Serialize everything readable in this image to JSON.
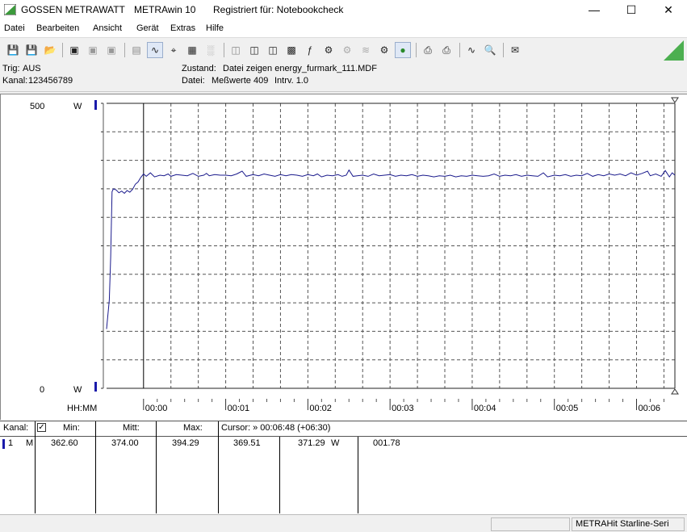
{
  "window": {
    "app_brand": "GOSSEN METRAWATT",
    "app_name": "METRAwin 10",
    "registration": "Registriert für: Notebookcheck"
  },
  "menu": [
    "Datei",
    "Bearbeiten",
    "Ansicht",
    "Gerät",
    "Extras",
    "Hilfe"
  ],
  "toolbar": {
    "icons": [
      "save-icon",
      "save-as-icon",
      "open-icon",
      "record-icon",
      "record-2-icon",
      "record-3-icon",
      "chart-view-icon",
      "zoom-chart-icon",
      "crosshair-icon",
      "table-view-icon",
      "histogram-icon",
      "device-icon",
      "device-2-icon",
      "device-3-icon",
      "computer-icon",
      "function-icon",
      "settings-icon",
      "settings-2-icon",
      "wave-icon",
      "trigger-icon",
      "start-icon",
      "print-icon",
      "print-preview-icon",
      "auto-scale-icon",
      "zoom-icon",
      "comment-icon"
    ],
    "accent": "#4caf50"
  },
  "info": {
    "trig_label": "Trig:",
    "trig_value": "AUS",
    "kanal_label": "Kanal:",
    "kanal_value": "123456789",
    "zustand_label": "Zustand:",
    "zustand_value": "Datei zeigen energy_furmark_111.MDF",
    "datei_label": "Datei:",
    "datei_value": "Meßwerte 409",
    "intrv_value": "Intrv. 1.0"
  },
  "chart_data": {
    "type": "line",
    "ymax_label": "500",
    "ymin_label": "0",
    "y_unit": "W",
    "ylim": [
      0,
      500
    ],
    "xlabel": "HH:MM",
    "x_ticks": [
      "00:00",
      "00:01",
      "00:02",
      "00:03",
      "00:04",
      "00:05",
      "00:06"
    ],
    "xlim_seconds": [
      -27,
      388
    ],
    "line_color": "#1a1a8c",
    "grid": true,
    "series": [
      {
        "points": [
          [
            -27,
            104
          ],
          [
            -25,
            155
          ],
          [
            -24,
            230
          ],
          [
            -23,
            345
          ],
          [
            -22,
            350
          ],
          [
            -20,
            348
          ],
          [
            -18,
            343
          ],
          [
            -16,
            346
          ],
          [
            -14,
            342
          ],
          [
            -12,
            347
          ],
          [
            -10,
            344
          ],
          [
            -8,
            349
          ],
          [
            -6,
            358
          ],
          [
            -4,
            362
          ],
          [
            -2,
            370
          ],
          [
            0,
            376
          ],
          [
            2,
            372
          ],
          [
            5,
            378
          ],
          [
            8,
            371
          ],
          [
            12,
            374
          ],
          [
            15,
            373
          ],
          [
            18,
            376
          ],
          [
            20,
            372
          ],
          [
            24,
            375
          ],
          [
            28,
            374
          ],
          [
            32,
            373
          ],
          [
            36,
            377
          ],
          [
            40,
            372
          ],
          [
            44,
            374
          ],
          [
            46,
            377
          ],
          [
            48,
            373
          ],
          [
            52,
            375
          ],
          [
            56,
            374
          ],
          [
            60,
            374
          ],
          [
            64,
            373
          ],
          [
            68,
            376
          ],
          [
            72,
            381
          ],
          [
            75,
            372
          ],
          [
            80,
            375
          ],
          [
            84,
            373
          ],
          [
            88,
            376
          ],
          [
            92,
            374
          ],
          [
            96,
            372
          ],
          [
            100,
            375
          ],
          [
            104,
            373
          ],
          [
            108,
            375
          ],
          [
            112,
            374
          ],
          [
            116,
            372
          ],
          [
            120,
            375
          ],
          [
            124,
            373
          ],
          [
            127,
            376
          ],
          [
            130,
            371
          ],
          [
            134,
            374
          ],
          [
            138,
            373
          ],
          [
            142,
            375
          ],
          [
            145,
            372
          ],
          [
            148,
            374
          ],
          [
            150,
            383
          ],
          [
            153,
            372
          ],
          [
            156,
            373
          ],
          [
            160,
            374
          ],
          [
            164,
            372
          ],
          [
            168,
            376
          ],
          [
            172,
            373
          ],
          [
            176,
            374
          ],
          [
            180,
            375
          ],
          [
            184,
            372
          ],
          [
            188,
            374
          ],
          [
            192,
            373
          ],
          [
            196,
            375
          ],
          [
            200,
            372
          ],
          [
            204,
            374
          ],
          [
            208,
            373
          ],
          [
            212,
            371
          ],
          [
            216,
            373
          ],
          [
            220,
            372
          ],
          [
            224,
            374
          ],
          [
            228,
            371
          ],
          [
            232,
            373
          ],
          [
            236,
            372
          ],
          [
            240,
            374
          ],
          [
            244,
            373
          ],
          [
            248,
            372
          ],
          [
            252,
            373
          ],
          [
            256,
            376
          ],
          [
            260,
            372
          ],
          [
            264,
            374
          ],
          [
            268,
            373
          ],
          [
            272,
            375
          ],
          [
            276,
            372
          ],
          [
            280,
            374
          ],
          [
            284,
            373
          ],
          [
            288,
            372
          ],
          [
            292,
            378
          ],
          [
            295,
            371
          ],
          [
            300,
            374
          ],
          [
            304,
            373
          ],
          [
            308,
            375
          ],
          [
            312,
            372
          ],
          [
            316,
            374
          ],
          [
            320,
            373
          ],
          [
            324,
            377
          ],
          [
            328,
            372
          ],
          [
            332,
            375
          ],
          [
            336,
            373
          ],
          [
            340,
            376
          ],
          [
            344,
            374
          ],
          [
            348,
            376
          ],
          [
            352,
            373
          ],
          [
            356,
            378
          ],
          [
            360,
            374
          ],
          [
            364,
            377
          ],
          [
            368,
            381
          ],
          [
            370,
            373
          ],
          [
            374,
            376
          ],
          [
            378,
            372
          ],
          [
            381,
            382
          ],
          [
            384,
            371
          ],
          [
            386,
            378
          ],
          [
            388,
            374
          ]
        ]
      }
    ]
  },
  "stats": {
    "header": {
      "kanal": "Kanal:",
      "min": "Min:",
      "mitt": "Mitt:",
      "max": "Max:",
      "cursor": "Cursor: » 00:06:48 (+06:30)"
    },
    "row": {
      "channel_num": "1",
      "channel_letter": "M",
      "min": "362.60",
      "mitt": "374.00",
      "max": "394.29",
      "cursor_a": "369.51",
      "cursor_b": "371.29",
      "unit": "W",
      "delta": "001.78"
    }
  },
  "statusbar": {
    "device": "METRAHit Starline-Seri"
  }
}
